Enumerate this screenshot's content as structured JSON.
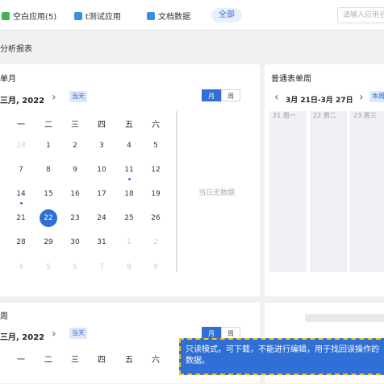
{
  "topbar": {
    "tabs": [
      {
        "label": "空白应用(5)",
        "color": "#3fb35a"
      },
      {
        "label": "t测试应用",
        "color": "#3a8ee6"
      },
      {
        "label": "文档数据",
        "color": "#3a8ee6"
      }
    ],
    "all_label": "全部",
    "search_placeholder": "请输入应用名"
  },
  "section": {
    "title": "分析报表"
  },
  "month_card": {
    "title": "单月",
    "month_label": "三月, 2022",
    "today_label": "当天",
    "view_month": "月",
    "view_week": "周",
    "weekdays": [
      "一",
      "二",
      "三",
      "四",
      "五",
      "六"
    ],
    "rows": [
      [
        "28",
        "1",
        "2",
        "3",
        "4",
        "5"
      ],
      [
        "7",
        "8",
        "9",
        "10",
        "11",
        "12"
      ],
      [
        "14",
        "15",
        "16",
        "17",
        "18",
        "19"
      ],
      [
        "21",
        "22",
        "23",
        "24",
        "25",
        "26"
      ],
      [
        "28",
        "29",
        "30",
        "31",
        "1",
        "2"
      ],
      [
        "4",
        "5",
        "6",
        "7",
        "8",
        "9"
      ]
    ],
    "selected_day": "22",
    "no_data": "当日无数据"
  },
  "week_card": {
    "title": "普通表单周",
    "week_label": "3月 21日-3月 27日",
    "today_label": "本周",
    "columns": [
      "21 周一",
      "22 周二",
      "23 周三"
    ]
  },
  "week2_card": {
    "title": "周",
    "month_label": "三月, 2022",
    "today_label": "当天",
    "view_month": "月",
    "view_week": "周",
    "weekdays": [
      "一",
      "二",
      "三",
      "四",
      "五",
      "六"
    ]
  },
  "tooltip": {
    "text": "只读模式，可下载，不能进行编辑，用于找回误操作的数据。"
  },
  "colors": {
    "accent": "#2f6fd6",
    "tooltip_border": "#f3c623"
  }
}
